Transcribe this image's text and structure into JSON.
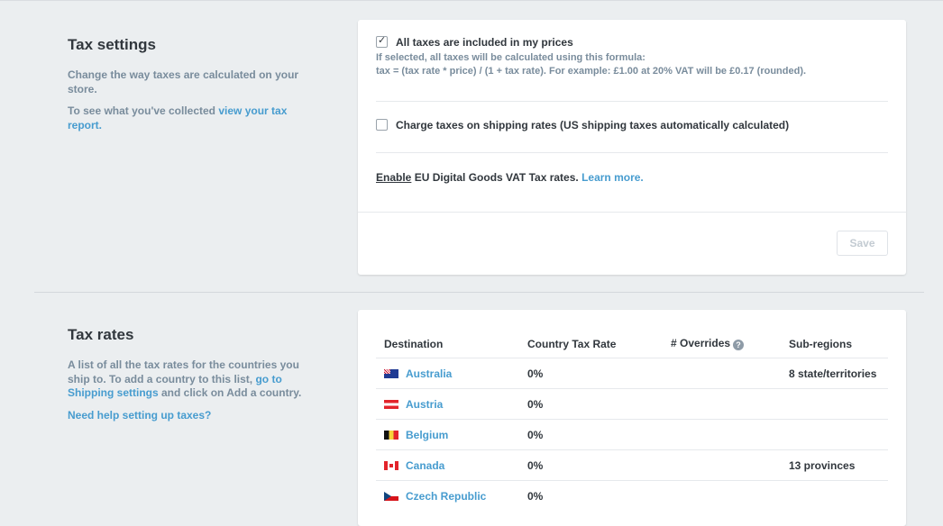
{
  "tax_settings": {
    "title": "Tax settings",
    "description": "Change the way taxes are calculated on your store.",
    "report_prefix": "To see what you've collected ",
    "report_link": "view your tax report.",
    "option_included": {
      "label": "All taxes are included in my prices",
      "checked": true,
      "help_line1": "If selected, all taxes will be calculated using this formula:",
      "help_line2": "tax = (tax rate * price) / (1 + tax rate). For example: £1.00 at 20% VAT will be £0.17 (rounded)."
    },
    "option_shipping": {
      "label": "Charge taxes on shipping rates (US shipping taxes automatically calculated)",
      "checked": false
    },
    "eu": {
      "enable_link": "Enable",
      "text": " EU Digital Goods VAT Tax rates. ",
      "learn_more": "Learn more."
    },
    "save_label": "Save"
  },
  "tax_rates": {
    "title": "Tax rates",
    "description_part1": "A list of all the tax rates for the countries you ship to. To add a country to this list, ",
    "shipping_link": "go to Shipping settings",
    "description_part2": " and click on Add a country.",
    "help_link": "Need help setting up taxes?",
    "columns": {
      "destination": "Destination",
      "country_rate": "Country Tax Rate",
      "overrides": "# Overrides",
      "subregions": "Sub-regions"
    },
    "overrides_icon": "question-icon",
    "rows": [
      {
        "country": "Australia",
        "rate": "0%",
        "overrides": "",
        "subregions": "8 state/territories",
        "flag": "australia-flag-icon"
      },
      {
        "country": "Austria",
        "rate": "0%",
        "overrides": "",
        "subregions": "",
        "flag": "austria-flag-icon"
      },
      {
        "country": "Belgium",
        "rate": "0%",
        "overrides": "",
        "subregions": "",
        "flag": "belgium-flag-icon"
      },
      {
        "country": "Canada",
        "rate": "0%",
        "overrides": "",
        "subregions": "13 provinces",
        "flag": "canada-flag-icon"
      },
      {
        "country": "Czech Republic",
        "rate": "0%",
        "overrides": "",
        "subregions": "",
        "flag": "czech-flag-icon"
      }
    ]
  },
  "colors": {
    "background": "#ebeef0",
    "link": "#479ccf",
    "muted_text": "#798c9c",
    "text": "#31373d"
  }
}
